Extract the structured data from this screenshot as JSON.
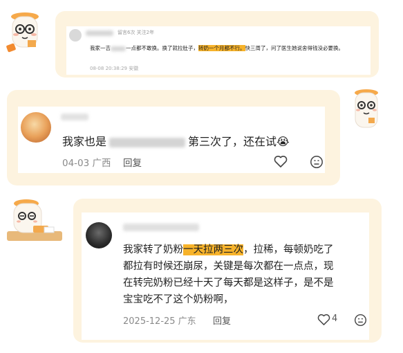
{
  "comments": [
    {
      "meta_partial": "留言6次 关注2年",
      "text_before": "我家一吉",
      "text_mid": "一点都不敢换。换了就拉肚子，",
      "highlight": "转奶一个月都不行。",
      "text_after": "快三周了，问了医生她说舍得钱没必要换。",
      "timestamp": "08-08 20:38:29 安徽"
    },
    {
      "text_before": "我家也是",
      "text_after": "第三次了，还在试",
      "emoji": "😭",
      "date_location": "04-03 广西",
      "reply_label": "回复"
    },
    {
      "text_before": "我家转了奶粉",
      "highlight": "一天拉两三次",
      "line1_after": "，拉稀，每顿奶吃了",
      "line2": "都拉有时候还崩尿，关键是每次都在一点点，现",
      "line3": "在转完奶粉已经十天了每天都是这样子，是不是",
      "line4": "宝宝吃不了这个奶粉啊，",
      "date_location": "2025-12-25 广东",
      "reply_label": "回复",
      "like_count": "4"
    }
  ],
  "icons": [
    "heart-icon",
    "emoji-reaction-icon",
    "mascot-icon"
  ],
  "colors": {
    "bubble": "#fdf3df",
    "highlight": "#f7b32b",
    "meta_text": "#9a9a9a",
    "body_text": "#222222"
  }
}
